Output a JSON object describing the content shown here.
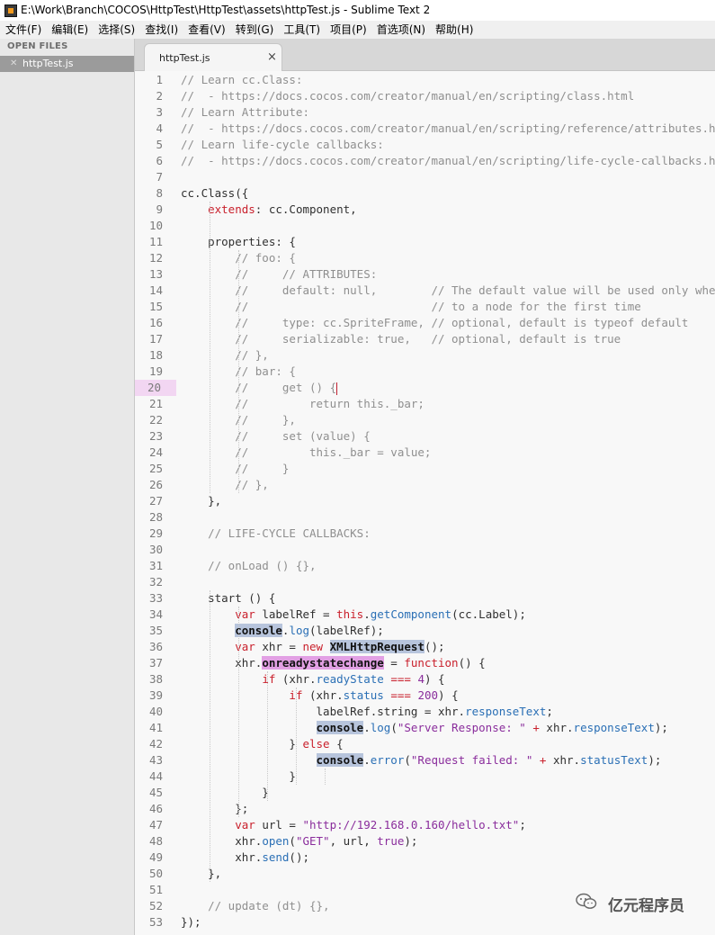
{
  "window": {
    "title": "E:\\Work\\Branch\\COCOS\\HttpTest\\HttpTest\\assets\\httpTest.js - Sublime Text 2"
  },
  "menu": [
    "文件(F)",
    "编辑(E)",
    "选择(S)",
    "查找(I)",
    "查看(V)",
    "转到(G)",
    "工具(T)",
    "项目(P)",
    "首选项(N)",
    "帮助(H)"
  ],
  "sidebar": {
    "header": "OPEN FILES",
    "files": [
      {
        "close": "✕",
        "name": "httpTest.js"
      }
    ]
  },
  "tabs": [
    {
      "label": "httpTest.js",
      "close": "×"
    }
  ],
  "editor": {
    "active_line": 20,
    "lines": [
      [
        [
          "c",
          "// Learn cc.Class:"
        ]
      ],
      [
        [
          "c",
          "//  - https://docs.cocos.com/creator/manual/en/scripting/class.html"
        ]
      ],
      [
        [
          "c",
          "// Learn Attribute:"
        ]
      ],
      [
        [
          "c",
          "//  - https://docs.cocos.com/creator/manual/en/scripting/reference/attributes.html"
        ]
      ],
      [
        [
          "c",
          "// Learn life-cycle callbacks:"
        ]
      ],
      [
        [
          "c",
          "//  - https://docs.cocos.com/creator/manual/en/scripting/life-cycle-callbacks.html"
        ]
      ],
      [],
      [
        [
          "p",
          "cc.Class({"
        ]
      ],
      [
        [
          "p",
          "    "
        ],
        [
          "k",
          "extends"
        ],
        [
          "p",
          ": cc.Component,"
        ]
      ],
      [],
      [
        [
          "p",
          "    properties: {"
        ]
      ],
      [
        [
          "c",
          "        // foo: {"
        ]
      ],
      [
        [
          "c",
          "        //     // ATTRIBUTES:"
        ]
      ],
      [
        [
          "c",
          "        //     default: null,        // The default value will be used only when the component attaching"
        ]
      ],
      [
        [
          "c",
          "        //                           // to a node for the first time"
        ]
      ],
      [
        [
          "c",
          "        //     type: cc.SpriteFrame, // optional, default is typeof default"
        ]
      ],
      [
        [
          "c",
          "        //     serializable: true,   // optional, default is true"
        ]
      ],
      [
        [
          "c",
          "        // },"
        ]
      ],
      [
        [
          "c",
          "        // bar: {"
        ]
      ],
      [
        [
          "c",
          "        //     get () {"
        ],
        [
          "caret",
          ""
        ]
      ],
      [
        [
          "c",
          "        //         return this._bar;"
        ]
      ],
      [
        [
          "c",
          "        //     },"
        ]
      ],
      [
        [
          "c",
          "        //     set (value) {"
        ]
      ],
      [
        [
          "c",
          "        //         this._bar = value;"
        ]
      ],
      [
        [
          "c",
          "        //     }"
        ]
      ],
      [
        [
          "c",
          "        // },"
        ]
      ],
      [
        [
          "p",
          "    },"
        ]
      ],
      [],
      [
        [
          "c",
          "    // LIFE-CYCLE CALLBACKS:"
        ]
      ],
      [],
      [
        [
          "c",
          "    // onLoad () {},"
        ]
      ],
      [],
      [
        [
          "p",
          "    start () {"
        ]
      ],
      [
        [
          "p",
          "        "
        ],
        [
          "k",
          "var"
        ],
        [
          "p",
          " labelRef = "
        ],
        [
          "k",
          "this"
        ],
        [
          "p",
          "."
        ],
        [
          "f",
          "getComponent"
        ],
        [
          "p",
          "(cc.Label);"
        ]
      ],
      [
        [
          "p",
          "        "
        ],
        [
          "hl",
          "console"
        ],
        [
          "p",
          "."
        ],
        [
          "f",
          "log"
        ],
        [
          "p",
          "(labelRef);"
        ]
      ],
      [
        [
          "p",
          "        "
        ],
        [
          "k",
          "var"
        ],
        [
          "p",
          " xhr = "
        ],
        [
          "k",
          "new"
        ],
        [
          "p",
          " "
        ],
        [
          "hl",
          "XMLHttpRequest"
        ],
        [
          "p",
          "();"
        ]
      ],
      [
        [
          "p",
          "        xhr."
        ],
        [
          "hlm",
          "onreadystatechange"
        ],
        [
          "p",
          " = "
        ],
        [
          "k",
          "function"
        ],
        [
          "p",
          "() {"
        ]
      ],
      [
        [
          "p",
          "            "
        ],
        [
          "k",
          "if"
        ],
        [
          "p",
          " (xhr."
        ],
        [
          "f",
          "readyState"
        ],
        [
          "p",
          " "
        ],
        [
          "k",
          "==="
        ],
        [
          "p",
          " "
        ],
        [
          "n",
          "4"
        ],
        [
          "p",
          ") {"
        ]
      ],
      [
        [
          "p",
          "                "
        ],
        [
          "k",
          "if"
        ],
        [
          "p",
          " (xhr."
        ],
        [
          "f",
          "status"
        ],
        [
          "p",
          " "
        ],
        [
          "k",
          "==="
        ],
        [
          "p",
          " "
        ],
        [
          "n",
          "200"
        ],
        [
          "p",
          ") {"
        ]
      ],
      [
        [
          "p",
          "                    labelRef.string = xhr."
        ],
        [
          "f",
          "responseText"
        ],
        [
          "p",
          ";"
        ]
      ],
      [
        [
          "p",
          "                    "
        ],
        [
          "hl",
          "console"
        ],
        [
          "p",
          "."
        ],
        [
          "f",
          "log"
        ],
        [
          "p",
          "("
        ],
        [
          "s",
          "\"Server Response: \""
        ],
        [
          "p",
          " "
        ],
        [
          "k",
          "+"
        ],
        [
          "p",
          " xhr."
        ],
        [
          "f",
          "responseText"
        ],
        [
          "p",
          ");"
        ]
      ],
      [
        [
          "p",
          "                } "
        ],
        [
          "k",
          "else"
        ],
        [
          "p",
          " {"
        ]
      ],
      [
        [
          "p",
          "                    "
        ],
        [
          "hl",
          "console"
        ],
        [
          "p",
          "."
        ],
        [
          "f",
          "error"
        ],
        [
          "p",
          "("
        ],
        [
          "s",
          "\"Request failed: \""
        ],
        [
          "p",
          " "
        ],
        [
          "k",
          "+"
        ],
        [
          "p",
          " xhr."
        ],
        [
          "f",
          "statusText"
        ],
        [
          "p",
          ");"
        ]
      ],
      [
        [
          "p",
          "                }"
        ]
      ],
      [
        [
          "p",
          "            }"
        ]
      ],
      [
        [
          "p",
          "        };"
        ]
      ],
      [
        [
          "p",
          "        "
        ],
        [
          "k",
          "var"
        ],
        [
          "p",
          " url = "
        ],
        [
          "s",
          "\"http://192.168.0.160/hello.txt\""
        ],
        [
          "p",
          ";"
        ]
      ],
      [
        [
          "p",
          "        xhr."
        ],
        [
          "f",
          "open"
        ],
        [
          "p",
          "("
        ],
        [
          "s",
          "\"GET\""
        ],
        [
          "p",
          ", url, "
        ],
        [
          "n",
          "true"
        ],
        [
          "p",
          ");"
        ]
      ],
      [
        [
          "p",
          "        xhr."
        ],
        [
          "f",
          "send"
        ],
        [
          "p",
          "();"
        ]
      ],
      [
        [
          "p",
          "    },"
        ]
      ],
      [],
      [
        [
          "c",
          "    // update (dt) {},"
        ]
      ],
      [
        [
          "p",
          "});"
        ]
      ]
    ]
  },
  "watermark": {
    "icon": "wechat-icon",
    "text": "亿元程序员"
  }
}
